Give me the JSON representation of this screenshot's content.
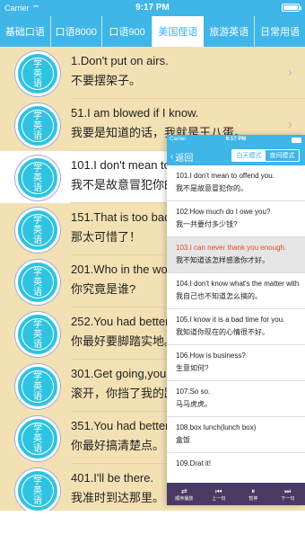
{
  "status": {
    "carrier": "Carrier",
    "time": "9:17 PM"
  },
  "tabs": [
    {
      "label": "基础口语"
    },
    {
      "label": "口语8000"
    },
    {
      "label": "口语900"
    },
    {
      "label": "美国俚语",
      "active": true
    },
    {
      "label": "旅游英语"
    },
    {
      "label": "日常用语"
    }
  ],
  "badge": {
    "line1": "学",
    "line2": "英",
    "line3": "语"
  },
  "list": [
    {
      "en": "1.Don't put on airs.",
      "zh": "不要摆架子。",
      "chevron": true
    },
    {
      "en": "51.I am blowed if I know.",
      "zh": "我要是知道的话，我就是王八蛋。",
      "chevron": true
    },
    {
      "en": "101.I don't mean to offend you.",
      "zh": "我不是故意冒犯你的。",
      "selected": true
    },
    {
      "en": "151.That is too bad.",
      "zh": "那太可惜了！"
    },
    {
      "en": "201.Who in the world are you?",
      "zh": "你究竟是谁?"
    },
    {
      "en": "252.You had better get down to earth.",
      "zh": "你最好要脚踏实地。"
    },
    {
      "en": "301.Get going,you are in my way.",
      "zh": "滚开，你挡了我的路。"
    },
    {
      "en": "351.You had better get it straight.",
      "zh": "你最好搞清楚点。"
    },
    {
      "en": "401.I'll be there.",
      "zh": "我准时到达那里。"
    }
  ],
  "overlay": {
    "status": {
      "carrier": "Carrier",
      "time": "9:17 PM"
    },
    "back_label": "返回",
    "segments": [
      {
        "label": "白天模式",
        "active": true
      },
      {
        "label": "夜间模式"
      }
    ],
    "items": [
      {
        "en": "101.I don't mean to offend you.",
        "zh": "我不是故意冒犯你的。"
      },
      {
        "en": "102.How much do I owe you?",
        "zh": "我一共要付多少钱?"
      },
      {
        "en": "103.I can never thank you enough.",
        "zh": "我不知道该怎样感激你才好。",
        "highlight": true
      },
      {
        "en": "104.I don't know what's the matter with",
        "zh": "我自己也不知道怎么搞的。"
      },
      {
        "en": "105.I know it is a bad time for you.",
        "zh": "我知道你现在的心情很不好。"
      },
      {
        "en": "106.How is business?",
        "zh": "生意如何?"
      },
      {
        "en": "107.So so.",
        "zh": "马马虎虎。"
      },
      {
        "en": "108.box lunch(lunch box)",
        "zh": "盒饭"
      },
      {
        "en": "109.Drat it!",
        "zh": ""
      }
    ],
    "player": [
      {
        "icon": "shuffle-icon",
        "glyph": "⇄",
        "label": "顺序播放"
      },
      {
        "icon": "previous-icon",
        "glyph": "⏮",
        "label": "上一句"
      },
      {
        "icon": "pause-icon",
        "glyph": "⏸",
        "label": "暂停"
      },
      {
        "icon": "next-icon",
        "glyph": "⏭",
        "label": "下一句"
      }
    ]
  },
  "colors": {
    "accent": "#3fb5e8",
    "list_bg": "#f3e1b3",
    "badge": "#2ec3e0",
    "player_bg": "#4a3a63",
    "highlight_text": "#e24a2c"
  }
}
